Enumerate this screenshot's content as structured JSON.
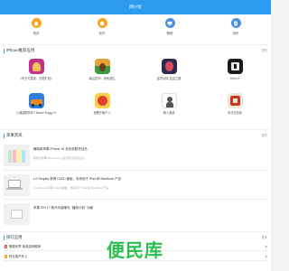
{
  "topbar": {
    "title": "网小智"
  },
  "quicknav": [
    {
      "label": "首页",
      "icon": "home-icon",
      "color": "#f5a623"
    },
    {
      "label": "软件",
      "icon": "package-icon",
      "color": "#f5a623"
    },
    {
      "label": "教程",
      "icon": "monitor-icon",
      "color": "#4a90e2"
    },
    {
      "label": "资讯",
      "icon": "document-icon",
      "color": "#4a90e2"
    }
  ],
  "games": {
    "title": "iPhone推荐应用",
    "more": "更多",
    "items": [
      {
        "name": "《时光与雷霆：无限扩张》",
        "colors": [
          "#c2338a",
          "#f3c05a"
        ]
      },
      {
        "name": "幕后影响：绝地逃生",
        "colors": [
          "#e8a23a",
          "#3a9a3f"
        ]
      },
      {
        "name": "金币侦探·自由之路",
        "colors": [
          "#2b2b52",
          "#d84a5a"
        ]
      },
      {
        "name": "Reed 2",
        "colors": [
          "#1a1a1a",
          "#e8e8e8"
        ]
      },
      {
        "name": "沙滩越野赛车2 Beach Buggy Racing 2",
        "colors": [
          "#f08a24",
          "#2f7de0"
        ]
      },
      {
        "name": "我要开客户人",
        "colors": [
          "#e13f34",
          "#f5d04a"
        ]
      },
      {
        "name": "萌人速递",
        "colors": [
          "#ffffff",
          "#555555"
        ]
      },
      {
        "name": "双马拉松街",
        "colors": [
          "#c9371f",
          "#f0e6d8"
        ]
      }
    ]
  },
  "news": {
    "title": "苹果资讯",
    "more": "更多",
    "items": [
      {
        "title": "曝新款苹果 iPhone 15 全系标配灵动岛",
        "sub": "曝新款苹果 iPhone 15 全系标配灵动岛设计"
      },
      {
        "title": "LG Display 获得 OLED 面板，未来用于 iPad 和 MacBook 产品",
        "sub": "LG Display 获得 OLED 面板，未来用于 iPad 和 MacBook 产品"
      },
      {
        "title": "苹果 iOS 17 新代功能曝光 \"播放计划\" 功能",
        "sub": ""
      }
    ]
  },
  "apps": {
    "title": "排行应用",
    "more": "更多",
    "items": [
      {
        "num": "1",
        "name": "蛋糕世界-收费游戏推荐",
        "color": "#e74c3c"
      },
      {
        "num": "2",
        "name": "别去摸汽车上",
        "color": "#f39c12"
      }
    ]
  },
  "watermark": "便民库"
}
